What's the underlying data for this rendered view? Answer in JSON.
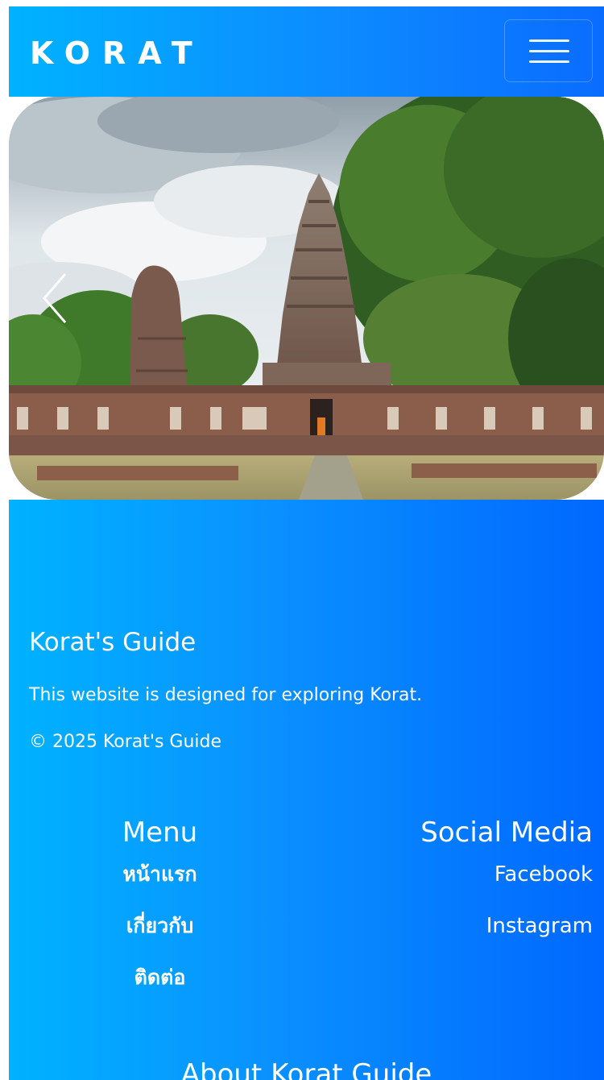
{
  "navbar": {
    "brand": "KORAT",
    "menu_toggle_icon": "hamburger-menu-icon"
  },
  "carousel": {
    "slide_image": "prasat-hin-phimai-temple-photo",
    "prev_icon": "chevron-left-icon"
  },
  "footer": {
    "title": "Korat's Guide",
    "description": "This website is designed for exploring Korat.",
    "copyright": "© 2025 Korat's Guide",
    "menu": {
      "heading": "Menu",
      "items": [
        "หน้าแรก",
        "เกี่ยวกับ",
        "ติดต่อ"
      ]
    },
    "social": {
      "heading": "Social Media",
      "items": [
        "Facebook",
        "Instagram"
      ]
    },
    "about_heading": "About Korat Guide"
  },
  "colors": {
    "gradient_start": "#00b2ff",
    "gradient_end": "#0068ff",
    "text": "#ffffff"
  }
}
